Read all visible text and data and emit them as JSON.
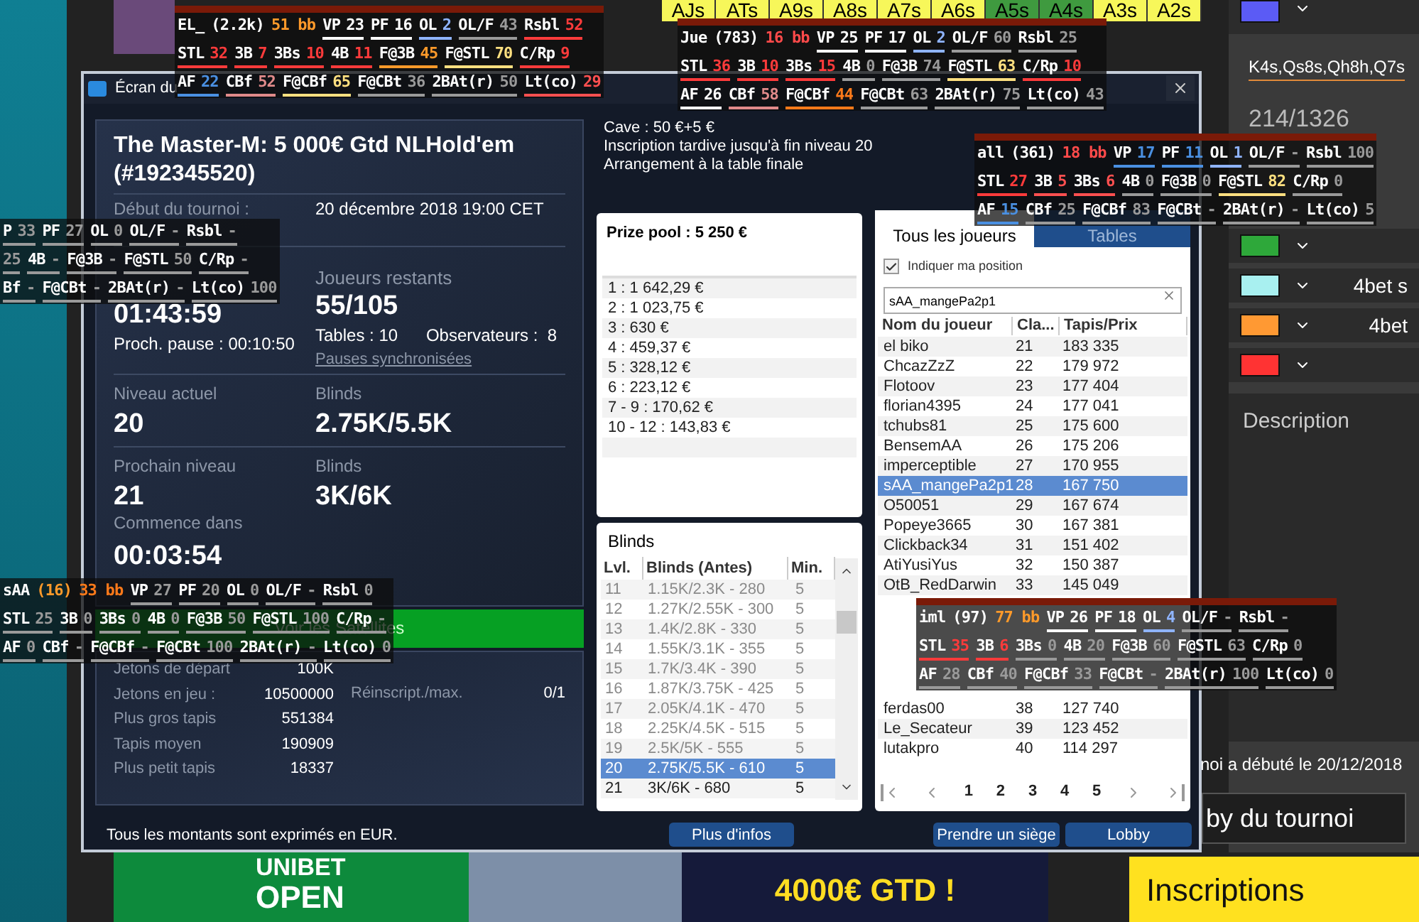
{
  "background": {
    "hand_grid": [
      {
        "label": "AJs",
        "color": "#f7f75a"
      },
      {
        "label": "ATs",
        "color": "#f7f75a"
      },
      {
        "label": "A9s",
        "color": "#f7f75a"
      },
      {
        "label": "A8s",
        "color": "#f7f75a"
      },
      {
        "label": "A7s",
        "color": "#f7f75a"
      },
      {
        "label": "A6s",
        "color": "#f7f75a"
      },
      {
        "label": "A5s",
        "color": "#3f9a3f"
      },
      {
        "label": "A4s",
        "color": "#3f9a3f"
      },
      {
        "label": "A3s",
        "color": "#f7f75a"
      },
      {
        "label": "A2s",
        "color": "#f7f75a"
      }
    ],
    "right_panel": {
      "range_text": "K4s,Qs8s,Qh8h,Q7s",
      "combos": "214/1326",
      "swatches": [
        {
          "color": "#5b5bf5"
        },
        {
          "color": "#2ea83a"
        },
        {
          "color": "#a8f0f0",
          "label": "4bet s"
        },
        {
          "color": "#ff9933",
          "label": "4bet"
        },
        {
          "color": "#ff3333"
        }
      ],
      "description_label": "Description",
      "status_text": "noi a débuté le 20/12/2018",
      "lobby_button": "by du tournoi",
      "register_button": "Inscriptions"
    },
    "banner": {
      "brand": "UNIBET",
      "event": "OPEN",
      "prize": "4000€ GTD !"
    }
  },
  "dialog": {
    "title": "Écran du",
    "tournament_title": "The Master-M: 5 000€ Gtd NLHold'em (#192345520)",
    "start_label": "Début du tournoi :",
    "start_value": "20 décembre 2018  19:00 CET",
    "elapsed": "01:43:59",
    "next_break": "Proch. pause : 00:10:50",
    "players_left_label": "Joueurs restants",
    "players_left": "55/105",
    "tables": "Tables : 10",
    "observers": "Observateurs :  8",
    "sync_link": "Pauses synchronisées",
    "levels": [
      {
        "label": "Niveau actuel",
        "value": "20",
        "blinds_label": "Blinds",
        "blinds": "2.75K/5.5K"
      },
      {
        "label": "Prochain niveau",
        "value": "21",
        "blinds_label": "Blinds",
        "blinds": "3K/6K"
      }
    ],
    "starts_in_label": "Commence dans",
    "starts_in": "00:03:54",
    "satellites_button": "Voir les Satellites",
    "chip_stats": [
      {
        "label": "Jetons de départ",
        "value": "100K"
      },
      {
        "label": "Jetons en jeu :",
        "value": "10500000"
      },
      {
        "label": "Plus gros tapis",
        "value": "551384"
      },
      {
        "label": "Tapis moyen",
        "value": "190909"
      },
      {
        "label": "Plus petit tapis",
        "value": "18337"
      }
    ],
    "rebuy_label": "Réinscript./max.",
    "rebuy_value": "0/1",
    "footer": "Tous les montants sont exprimés en EUR.",
    "info_lines": [
      "Cave : 50 €+5 €",
      "Inscription tardive jusqu'à fin niveau 20",
      "Arrangement à la table finale"
    ],
    "prize_pool": {
      "title": "Prize pool : 5 250 €",
      "payouts": [
        "1 : 1 642,29 €",
        "2 : 1 023,75 €",
        "3 : 630 €",
        "4 : 459,37 €",
        "5 : 328,12 €",
        "6 : 223,12 €",
        "7 - 9 : 170,62 €",
        "10 - 12 : 143,83 €"
      ]
    },
    "blinds": {
      "title": "Blinds",
      "columns": [
        "Lvl.",
        "Blinds (Antes)",
        "Min."
      ],
      "rows": [
        {
          "level": "11",
          "blinds": "1.15K/2.3K - 280",
          "min": "5",
          "selected": false
        },
        {
          "level": "12",
          "blinds": "1.27K/2.55K - 300",
          "min": "5",
          "selected": false
        },
        {
          "level": "13",
          "blinds": "1.4K/2.8K - 330",
          "min": "5",
          "selected": false
        },
        {
          "level": "14",
          "blinds": "1.55K/3.1K - 355",
          "min": "5",
          "selected": false
        },
        {
          "level": "15",
          "blinds": "1.7K/3.4K - 390",
          "min": "5",
          "selected": false
        },
        {
          "level": "16",
          "blinds": "1.87K/3.75K - 425",
          "min": "5",
          "selected": false
        },
        {
          "level": "17",
          "blinds": "2.05K/4.1K - 470",
          "min": "5",
          "selected": false
        },
        {
          "level": "18",
          "blinds": "2.25K/4.5K - 515",
          "min": "5",
          "selected": false
        },
        {
          "level": "19",
          "blinds": "2.5K/5K - 555",
          "min": "5",
          "selected": false
        },
        {
          "level": "20",
          "blinds": "2.75K/5.5K - 610",
          "min": "5",
          "selected": true
        },
        {
          "level": "21",
          "blinds": "3K/6K - 680",
          "min": "5",
          "selected": false
        }
      ]
    },
    "more_info_button": "Plus d'infos",
    "players": {
      "tabs": [
        {
          "label": "Tous les joueurs",
          "selected": true
        },
        {
          "label": "Tables",
          "selected": false
        }
      ],
      "show_position": {
        "label": "Indiquer ma position",
        "checked": true
      },
      "search_value": "sAA_mangePa2p1",
      "columns": [
        "Nom du joueur",
        "Cla...",
        "Tapis/Prix"
      ],
      "rows_top": [
        {
          "name": "el biko",
          "rank": "21",
          "stack": "183 335",
          "selected": false
        },
        {
          "name": "ChcazZzZ",
          "rank": "22",
          "stack": "179 972",
          "selected": false
        },
        {
          "name": "Flotoov",
          "rank": "23",
          "stack": "177 404",
          "selected": false
        },
        {
          "name": "florian4395",
          "rank": "24",
          "stack": "177 041",
          "selected": false
        },
        {
          "name": "tchubs81",
          "rank": "25",
          "stack": "175 600",
          "selected": false
        },
        {
          "name": "BensemAA",
          "rank": "26",
          "stack": "175 206",
          "selected": false
        },
        {
          "name": "imperceptible",
          "rank": "27",
          "stack": "170 955",
          "selected": false
        },
        {
          "name": "sAA_mangePa2p1",
          "rank": "28",
          "stack": "167 750",
          "selected": true
        },
        {
          "name": "O50051",
          "rank": "29",
          "stack": "167 674",
          "selected": false
        },
        {
          "name": "Popeye3665",
          "rank": "30",
          "stack": "167 381",
          "selected": false
        },
        {
          "name": "Clickback34",
          "rank": "31",
          "stack": "151 402",
          "selected": false
        },
        {
          "name": "AtiYusiYus",
          "rank": "32",
          "stack": "150 387",
          "selected": false
        },
        {
          "name": "OtB_RedDarwin",
          "rank": "33",
          "stack": "145 049",
          "selected": false
        }
      ],
      "rows_bottom": [
        {
          "name": "ferdas00",
          "rank": "38",
          "stack": "127 740",
          "selected": false
        },
        {
          "name": "Le_Secateur",
          "rank": "39",
          "stack": "123 452",
          "selected": false
        },
        {
          "name": "lutakpro",
          "rank": "40",
          "stack": "114 297",
          "selected": false
        }
      ],
      "pages": [
        "1",
        "2",
        "3",
        "4",
        "5"
      ]
    },
    "seat_button": "Prendre un siège",
    "lobby_button": "Lobby"
  },
  "huds": [
    {
      "top_bar": true,
      "name": "EL_",
      "tags": [
        {
          "value": "(2.2k)",
          "color": "#ffffff"
        },
        {
          "value": "51 bb",
          "color": "#ff9a2a"
        }
      ],
      "lines": [
        [
          {
            "label": "VP",
            "value": "23",
            "color": "#ffffff"
          },
          {
            "label": "PF",
            "value": "16",
            "color": "#ffffff"
          },
          {
            "label": "OL",
            "value": "2",
            "color": "#8fb4ff"
          },
          {
            "label": "OL/F",
            "value": "43",
            "color": "#9a9a9a"
          },
          {
            "label": "Rsbl",
            "value": "52",
            "color": "#ff3b3b"
          }
        ],
        [
          {
            "label": "STL",
            "value": "32",
            "color": "#ff3b3b"
          },
          {
            "label": "3B",
            "value": "7",
            "color": "#ff3b3b"
          },
          {
            "label": "3Bs",
            "value": "10",
            "color": "#ff3b3b"
          },
          {
            "label": "4B",
            "value": "11",
            "color": "#ff3b3b"
          },
          {
            "label": "F@3B",
            "value": "45",
            "color": "#ff9a2a"
          },
          {
            "label": "F@STL",
            "value": "70",
            "color": "#ffe080"
          },
          {
            "label": "C/Rp",
            "value": "9",
            "color": "#ff3b3b"
          }
        ],
        [
          {
            "label": "AF",
            "value": "22",
            "color": "#4a90e2"
          },
          {
            "label": "CBf",
            "value": "52",
            "color": "#e08a8a"
          },
          {
            "label": "F@CBf",
            "value": "65",
            "color": "#ffe080"
          },
          {
            "label": "F@CBt",
            "value": "36",
            "color": "#9a9a9a"
          },
          {
            "label": "2BAt(r)",
            "value": "50",
            "color": "#9a9a9a"
          },
          {
            "label": "Lt(co)",
            "value": "29",
            "color": "#ff5050"
          }
        ]
      ]
    },
    {
      "top_bar": true,
      "name": "Jue",
      "tags": [
        {
          "value": "(783)",
          "color": "#ffffff"
        },
        {
          "value": "16 bb",
          "color": "#ff4a4a"
        }
      ],
      "lines": [
        [
          {
            "label": "VP",
            "value": "25",
            "color": "#ffffff"
          },
          {
            "label": "PF",
            "value": "17",
            "color": "#ffffff"
          },
          {
            "label": "OL",
            "value": "2",
            "color": "#8fb4ff"
          },
          {
            "label": "OL/F",
            "value": "60",
            "color": "#9a9a9a"
          },
          {
            "label": "Rsbl",
            "value": "25",
            "color": "#9a9a9a"
          }
        ],
        [
          {
            "label": "STL",
            "value": "36",
            "color": "#ff3b3b"
          },
          {
            "label": "3B",
            "value": "10",
            "color": "#ff3b3b"
          },
          {
            "label": "3Bs",
            "value": "15",
            "color": "#ff3b3b"
          },
          {
            "label": "4B",
            "value": "0",
            "color": "#9a9a9a"
          },
          {
            "label": "F@3B",
            "value": "74",
            "color": "#9a9a9a"
          },
          {
            "label": "F@STL",
            "value": "63",
            "color": "#ffe080"
          },
          {
            "label": "C/Rp",
            "value": "10",
            "color": "#ff3b3b"
          }
        ],
        [
          {
            "label": "AF",
            "value": "26",
            "color": "#ffffff"
          },
          {
            "label": "CBf",
            "value": "58",
            "color": "#e08a8a"
          },
          {
            "label": "F@CBf",
            "value": "44",
            "color": "#ff7a1a"
          },
          {
            "label": "F@CBt",
            "value": "63",
            "color": "#9a9a9a"
          },
          {
            "label": "2BAt(r)",
            "value": "75",
            "color": "#9a9a9a"
          },
          {
            "label": "Lt(co)",
            "value": "43",
            "color": "#9a9a9a"
          }
        ]
      ]
    },
    {
      "top_bar": true,
      "name": "all",
      "tags": [
        {
          "value": "(361)",
          "color": "#ffffff"
        },
        {
          "value": "18 bb",
          "color": "#ff4a4a"
        }
      ],
      "lines": [
        [
          {
            "label": "VP",
            "value": "17",
            "color": "#4a90e2"
          },
          {
            "label": "PF",
            "value": "11",
            "color": "#4a90e2"
          },
          {
            "label": "OL",
            "value": "1",
            "color": "#8fb4ff"
          },
          {
            "label": "OL/F",
            "value": "-",
            "color": "#9a9a9a"
          },
          {
            "label": "Rsbl",
            "value": "100",
            "color": "#9a9a9a"
          }
        ],
        [
          {
            "label": "STL",
            "value": "27",
            "color": "#ff3b3b"
          },
          {
            "label": "3B",
            "value": "5",
            "color": "#ff5050"
          },
          {
            "label": "3Bs",
            "value": "6",
            "color": "#ff5050"
          },
          {
            "label": "4B",
            "value": "0",
            "color": "#9a9a9a"
          },
          {
            "label": "F@3B",
            "value": "0",
            "color": "#9a9a9a"
          },
          {
            "label": "F@STL",
            "value": "82",
            "color": "#ffe080"
          },
          {
            "label": "C/Rp",
            "value": "0",
            "color": "#9a9a9a"
          }
        ],
        [
          {
            "label": "AF",
            "value": "15",
            "color": "#4a90e2"
          },
          {
            "label": "CBf",
            "value": "25",
            "color": "#9a9a9a"
          },
          {
            "label": "F@CBf",
            "value": "83",
            "color": "#9a9a9a"
          },
          {
            "label": "F@CBt",
            "value": "-",
            "color": "#9a9a9a"
          },
          {
            "label": "2BAt(r)",
            "value": "-",
            "color": "#9a9a9a"
          },
          {
            "label": "Lt(co)",
            "value": "5",
            "color": "#9a9a9a"
          }
        ]
      ]
    },
    {
      "top_bar": false,
      "lines": [
        [
          {
            "label": "P",
            "value": "33",
            "color": "#9a9a9a"
          },
          {
            "label": "PF",
            "value": "27",
            "color": "#9a9a9a"
          },
          {
            "label": "OL",
            "value": "0",
            "color": "#9a9a9a"
          },
          {
            "label": "OL/F",
            "value": "-",
            "color": "#9a9a9a"
          },
          {
            "label": "Rsbl",
            "value": "-",
            "color": "#9a9a9a"
          }
        ],
        [
          {
            "value": "25",
            "color": "#9a9a9a"
          },
          {
            "label": "4B",
            "value": "-",
            "color": "#9a9a9a"
          },
          {
            "label": "F@3B",
            "value": "-",
            "color": "#9a9a9a"
          },
          {
            "label": "F@STL",
            "value": "50",
            "color": "#9a9a9a"
          },
          {
            "label": "C/Rp",
            "value": "-",
            "color": "#9a9a9a"
          }
        ],
        [
          {
            "label": "Bf",
            "value": "-",
            "color": "#9a9a9a"
          },
          {
            "label": "F@CBt",
            "value": "-",
            "color": "#9a9a9a"
          },
          {
            "label": "2BAt(r)",
            "value": "-",
            "color": "#9a9a9a"
          },
          {
            "label": "Lt(co)",
            "value": "100",
            "color": "#9a9a9a"
          }
        ]
      ]
    },
    {
      "top_bar": false,
      "name": "sAA",
      "tags": [
        {
          "value": "(16)",
          "color": "#ff9a2a"
        },
        {
          "value": "33 bb",
          "color": "#ff7a1a"
        }
      ],
      "lines": [
        [
          {
            "label": "VP",
            "value": "27",
            "color": "#9a9a9a"
          },
          {
            "label": "PF",
            "value": "20",
            "color": "#9a9a9a"
          },
          {
            "label": "OL",
            "value": "0",
            "color": "#9a9a9a"
          },
          {
            "label": "OL/F",
            "value": "-",
            "color": "#9a9a9a"
          },
          {
            "label": "Rsbl",
            "value": "0",
            "color": "#9a9a9a"
          }
        ],
        [
          {
            "label": "STL",
            "value": "25",
            "color": "#9a9a9a"
          },
          {
            "label": "3B",
            "value": "0",
            "color": "#9a9a9a"
          },
          {
            "label": "3Bs",
            "value": "0",
            "color": "#9a9a9a"
          },
          {
            "label": "4B",
            "value": "0",
            "color": "#9a9a9a"
          },
          {
            "label": "F@3B",
            "value": "50",
            "color": "#9a9a9a"
          },
          {
            "label": "F@STL",
            "value": "100",
            "color": "#9a9a9a"
          },
          {
            "label": "C/Rp",
            "value": "-",
            "color": "#9a9a9a"
          }
        ],
        [
          {
            "label": "AF",
            "value": "0",
            "color": "#9a9a9a"
          },
          {
            "label": "CBf",
            "value": "-",
            "color": "#9a9a9a"
          },
          {
            "label": "F@CBf",
            "value": "-",
            "color": "#9a9a9a"
          },
          {
            "label": "F@CBt",
            "value": "100",
            "color": "#9a9a9a"
          },
          {
            "label": "2BAt(r)",
            "value": "-",
            "color": "#9a9a9a"
          },
          {
            "label": "Lt(co)",
            "value": "0",
            "color": "#9a9a9a"
          }
        ]
      ]
    },
    {
      "top_bar": true,
      "name": "iml",
      "tags": [
        {
          "value": "(97)",
          "color": "#ffffff"
        },
        {
          "value": "77 bb",
          "color": "#ff9a2a"
        }
      ],
      "lines": [
        [
          {
            "label": "VP",
            "value": "26",
            "color": "#ffffff"
          },
          {
            "label": "PF",
            "value": "18",
            "color": "#ffffff"
          },
          {
            "label": "OL",
            "value": "4",
            "color": "#8fb4ff"
          },
          {
            "label": "OL/F",
            "value": "-",
            "color": "#9a9a9a"
          },
          {
            "label": "Rsbl",
            "value": "-",
            "color": "#9a9a9a"
          }
        ],
        [
          {
            "label": "STL",
            "value": "35",
            "color": "#ff3b3b"
          },
          {
            "label": "3B",
            "value": "6",
            "color": "#ff3b3b"
          },
          {
            "label": "3Bs",
            "value": "0",
            "color": "#9a9a9a"
          },
          {
            "label": "4B",
            "value": "20",
            "color": "#9a9a9a"
          },
          {
            "label": "F@3B",
            "value": "60",
            "color": "#9a9a9a"
          },
          {
            "label": "F@STL",
            "value": "63",
            "color": "#9a9a9a"
          },
          {
            "label": "C/Rp",
            "value": "0",
            "color": "#9a9a9a"
          }
        ],
        [
          {
            "label": "AF",
            "value": "28",
            "color": "#9a9a9a"
          },
          {
            "label": "CBf",
            "value": "40",
            "color": "#9a9a9a"
          },
          {
            "label": "F@CBf",
            "value": "33",
            "color": "#9a9a9a"
          },
          {
            "label": "F@CBt",
            "value": "-",
            "color": "#9a9a9a"
          },
          {
            "label": "2BAt(r)",
            "value": "100",
            "color": "#9a9a9a"
          },
          {
            "label": "Lt(co)",
            "value": "0",
            "color": "#9a9a9a"
          }
        ]
      ]
    }
  ]
}
